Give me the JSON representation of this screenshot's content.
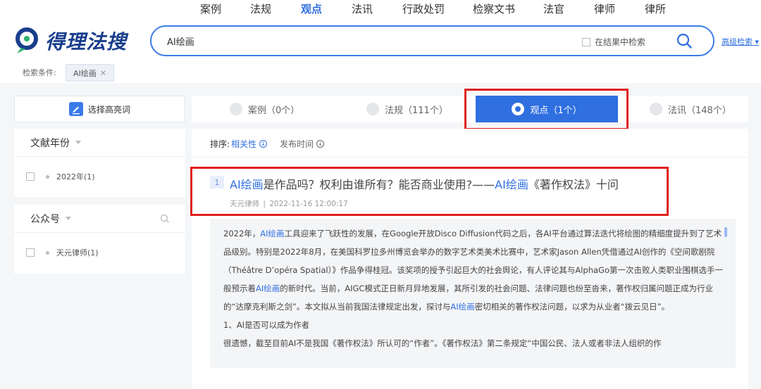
{
  "nav": {
    "items": [
      "案例",
      "法规",
      "观点",
      "法讯",
      "行政处罚",
      "检察文书",
      "法官",
      "律师",
      "律所"
    ],
    "active_index": 2
  },
  "logo": {
    "text": "得理法搜"
  },
  "search": {
    "value": "AI绘画",
    "in_result_label": "在结果中检索",
    "advanced_label": "高级检索"
  },
  "conditions": {
    "label": "检索条件:",
    "tag": "AI绘画",
    "tag_close": "×"
  },
  "sidebar": {
    "highlight_label": "选择高亮词",
    "year": {
      "title": "文献年份",
      "items": [
        "2022年(1)"
      ]
    },
    "wechat": {
      "title": "公众号",
      "items": [
        "天元律师(1)"
      ]
    }
  },
  "tabs": [
    {
      "label": "案例（0个）"
    },
    {
      "label": "法规（111个）"
    },
    {
      "label": "观点（1个）"
    },
    {
      "label": "法讯（148个）"
    }
  ],
  "sort": {
    "label": "排序:",
    "options": [
      "相关性",
      "发布时间"
    ],
    "active": "相关性"
  },
  "result": {
    "number": "1",
    "title_parts": [
      "AI绘画",
      "是作品吗？权利由谁所有？能否商业使用?——",
      "AI绘画",
      "《著作权法》十问"
    ],
    "source": "天元律师",
    "sep": "|",
    "date": "2022-11-16 12:00:17",
    "abstract": [
      [
        "2022年，",
        "AI绘画",
        "工具迎来了飞跃性的发展，在Google开放Disco Diffusion代码之后，各AI平台通过算法迭代将绘图的精细度提升到了艺术品级别。特别是2022年8月，在美国科罗拉多州博览会举办的数字艺术类美术比赛中，艺术家Jason Allen凭借通过AI创作的《空间歌剧院（Théâtre D’opéra Spatial）》作品争得桂冠。该奖项的授予引起巨大的社会舆论，有人评论其与AlphaGo第一次击败人类职业围棋选手一般预示着",
        "AI绘画",
        "的新时代。当前，AIGC模式正日新月异地发展，其所引发的社会问题、法律问题也纷至沓来，著作权归属问题正成为行业的“达摩克利斯之剑”。本文拟从当前我国法律规定出发，探讨与",
        "AI绘画",
        "密切相关的著作权法问题，以求为从业者“拨云见日”。"
      ],
      "1、AI是否可以成为作者",
      "很遗憾，截至目前AI不是我国《著作权法》所认可的“作者”。《著作权法》第二条规定“中国公民、法人或者非法人组织的作"
    ]
  },
  "colors": {
    "accent": "#2f6fe0",
    "highlight_box": "#e02020"
  }
}
